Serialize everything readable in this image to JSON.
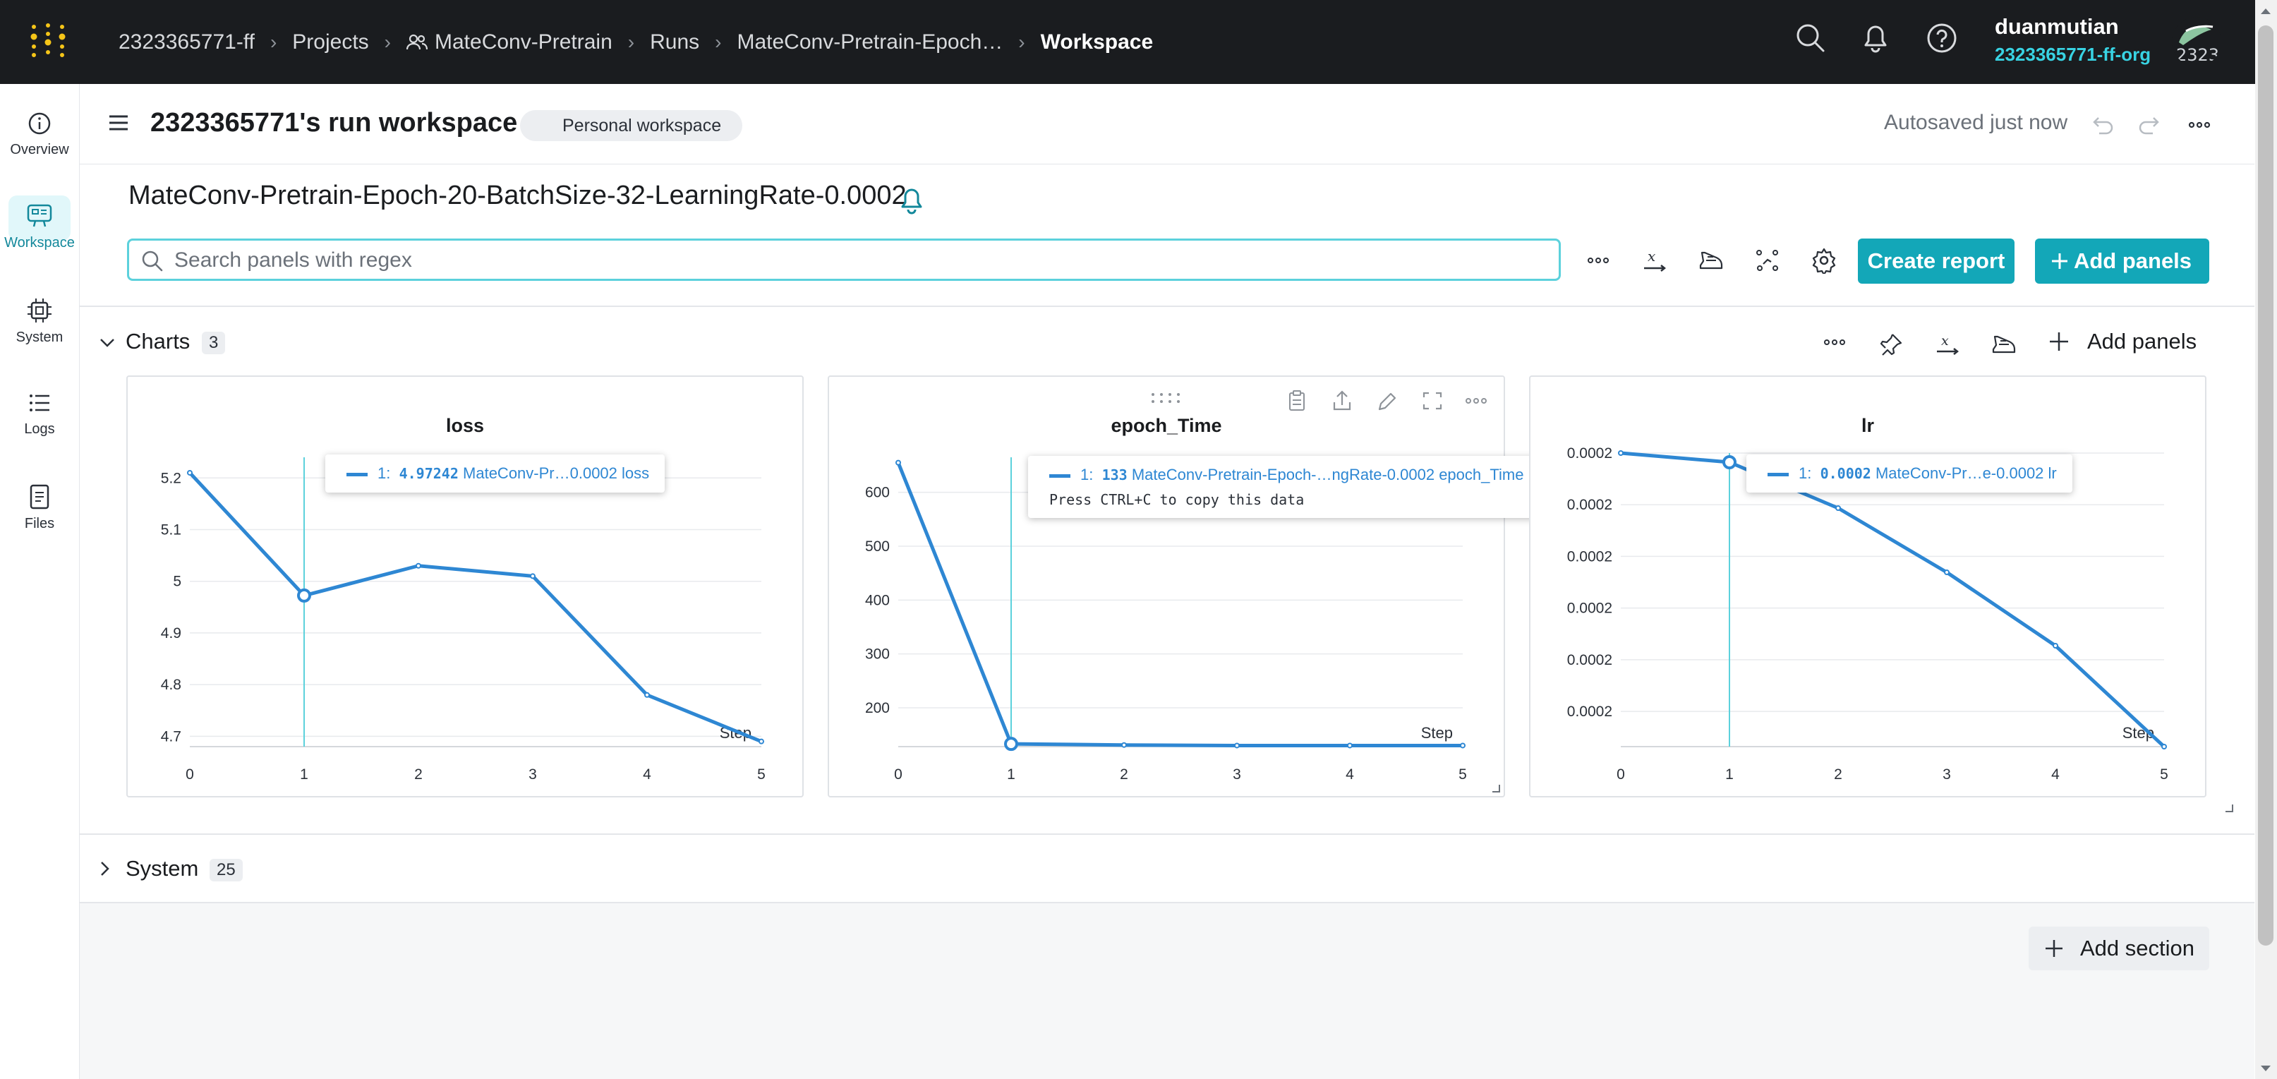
{
  "topbar": {
    "breadcrumbs": [
      "2323365771-ff",
      "Projects",
      "MateConv-Pretrain",
      "Runs",
      "MateConv-Pretrain-Epoch…",
      "Workspace"
    ],
    "user_name": "duanmutian",
    "user_org": "2323365771-ff-org",
    "avatar_text": "2323"
  },
  "sidenav": {
    "items": [
      {
        "label": "Overview",
        "icon": "info-icon"
      },
      {
        "label": "Workspace",
        "icon": "workspace-icon"
      },
      {
        "label": "System",
        "icon": "chip-icon"
      },
      {
        "label": "Logs",
        "icon": "list-icon"
      },
      {
        "label": "Files",
        "icon": "file-icon"
      }
    ],
    "active": "Workspace"
  },
  "header": {
    "title": "2323365771's run workspace",
    "badge": "Personal workspace",
    "autosave": "Autosaved just now"
  },
  "run": {
    "name": "MateConv-Pretrain-Epoch-20-BatchSize-32-LearningRate-0.0002"
  },
  "search": {
    "placeholder": "Search panels with regex"
  },
  "toolbar": {
    "create_report": "Create report",
    "add_panels": "Add panels"
  },
  "sections": [
    {
      "title": "Charts",
      "count": "3",
      "add_panels": "Add panels",
      "expanded": true
    },
    {
      "title": "System",
      "count": "25",
      "expanded": false
    }
  ],
  "add_section": "Add section",
  "colors": {
    "accent": "#13a7b8",
    "series": "#2e87d3",
    "topbar": "#1a1c1f",
    "cursor": "#5cd1dc"
  },
  "chart_data": [
    {
      "type": "line",
      "title": "loss",
      "xlabel": "Step",
      "x": [
        0,
        1,
        2,
        3,
        4,
        5
      ],
      "series": [
        {
          "values": [
            5.21,
            4.97242,
            5.03,
            5.01,
            4.78,
            4.69
          ]
        }
      ],
      "xlim": [
        0,
        5
      ],
      "ylim": [
        4.68,
        5.24
      ],
      "yticks": [
        "5.2",
        "5.1",
        "5",
        "4.9",
        "4.8",
        "4.7"
      ],
      "xticks": [
        "0",
        "1",
        "2",
        "3",
        "4",
        "5"
      ],
      "grid": true,
      "tooltip": {
        "step": "1",
        "value": "4.97242",
        "run": "MateConv-Pr…0.0002",
        "metric": "loss"
      }
    },
    {
      "type": "line",
      "title": "epoch_Time",
      "xlabel": "Step",
      "x": [
        0,
        1,
        2,
        3,
        4,
        5
      ],
      "series": [
        {
          "values": [
            655,
            133,
            131,
            130,
            130,
            130
          ]
        }
      ],
      "xlim": [
        0,
        5
      ],
      "ylim": [
        128,
        665
      ],
      "yticks": [
        "600",
        "500",
        "400",
        "300",
        "200"
      ],
      "xticks": [
        "0",
        "1",
        "2",
        "3",
        "4",
        "5"
      ],
      "grid": true,
      "tooltip": {
        "step": "1",
        "value": "133",
        "run": "MateConv-Pretrain-Epoch-…ngRate-0.0002",
        "metric": "epoch_Time",
        "hint": "Press CTRL+C to copy this data"
      }
    },
    {
      "type": "line",
      "title": "lr",
      "xlabel": "Step",
      "x": [
        0,
        1,
        2,
        3,
        4,
        5
      ],
      "series": [
        {
          "values": [
            0.0002,
            0.000199,
            0.000194,
            0.000187,
            0.000179,
            0.000168
          ]
        }
      ],
      "xlim": [
        0,
        5
      ],
      "ylim": [
        0.000168,
        0.0002
      ],
      "yticks": [
        "0.0002",
        "0.0002",
        "0.0002",
        "0.0002",
        "0.0002",
        "0.0002"
      ],
      "xticks": [
        "0",
        "1",
        "2",
        "3",
        "4",
        "5"
      ],
      "grid": true,
      "tooltip": {
        "step": "1",
        "value": "0.0002",
        "run": "MateConv-Pr…e-0.0002",
        "metric": "lr"
      }
    }
  ]
}
